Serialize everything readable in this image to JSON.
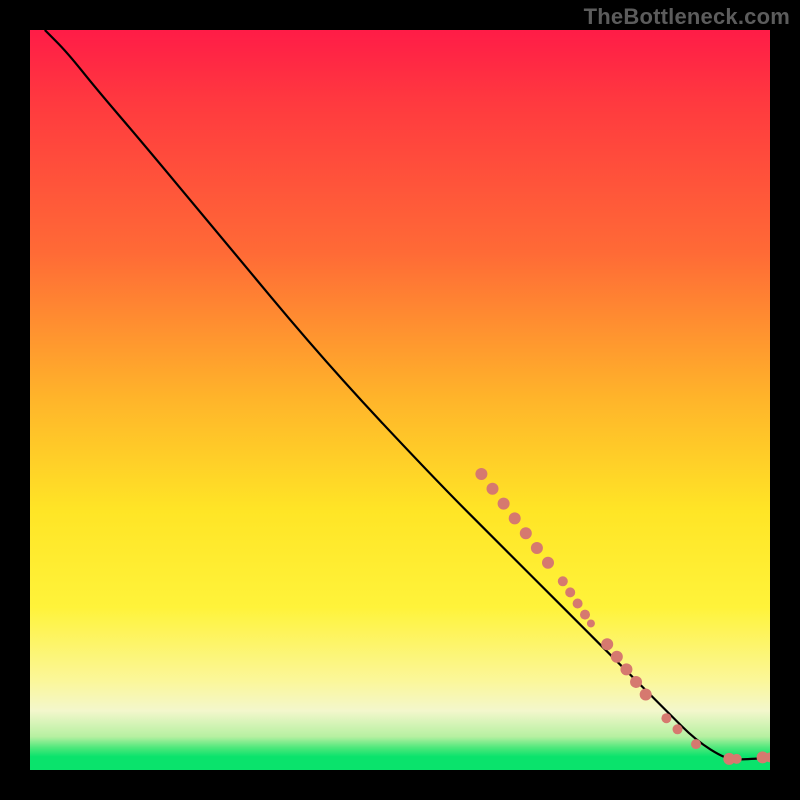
{
  "watermark": "TheBottleneck.com",
  "chart_data": {
    "type": "line",
    "title": "",
    "xlabel": "",
    "ylabel": "",
    "xlim": [
      0,
      100
    ],
    "ylim": [
      0,
      100
    ],
    "curve": [
      {
        "x": 2,
        "y": 100
      },
      {
        "x": 5,
        "y": 97
      },
      {
        "x": 9,
        "y": 92
      },
      {
        "x": 15,
        "y": 85
      },
      {
        "x": 25,
        "y": 73
      },
      {
        "x": 40,
        "y": 55
      },
      {
        "x": 55,
        "y": 39
      },
      {
        "x": 64,
        "y": 30
      },
      {
        "x": 72,
        "y": 22
      },
      {
        "x": 80,
        "y": 14
      },
      {
        "x": 86,
        "y": 8
      },
      {
        "x": 90,
        "y": 4
      },
      {
        "x": 94,
        "y": 1.5
      },
      {
        "x": 96,
        "y": 1.4
      },
      {
        "x": 99,
        "y": 1.6
      }
    ],
    "points_cluster_top": [
      {
        "x": 61,
        "y": 40,
        "r": 6
      },
      {
        "x": 62.5,
        "y": 38,
        "r": 6
      },
      {
        "x": 64,
        "y": 36,
        "r": 6
      },
      {
        "x": 65.5,
        "y": 34,
        "r": 6
      },
      {
        "x": 67,
        "y": 32,
        "r": 6
      },
      {
        "x": 68.5,
        "y": 30,
        "r": 6
      },
      {
        "x": 70,
        "y": 28,
        "r": 6
      }
    ],
    "points_cluster_mid": [
      {
        "x": 72,
        "y": 25.5,
        "r": 5
      },
      {
        "x": 73,
        "y": 24,
        "r": 5
      },
      {
        "x": 74,
        "y": 22.5,
        "r": 5
      },
      {
        "x": 75,
        "y": 21,
        "r": 5
      },
      {
        "x": 75.8,
        "y": 19.8,
        "r": 4
      }
    ],
    "points_cluster_low": [
      {
        "x": 78,
        "y": 17,
        "r": 6
      },
      {
        "x": 79.3,
        "y": 15.3,
        "r": 6
      },
      {
        "x": 80.6,
        "y": 13.6,
        "r": 6
      },
      {
        "x": 81.9,
        "y": 11.9,
        "r": 6
      },
      {
        "x": 83.2,
        "y": 10.2,
        "r": 6
      }
    ],
    "points_scatter": [
      {
        "x": 86,
        "y": 7,
        "r": 5
      },
      {
        "x": 87.5,
        "y": 5.5,
        "r": 5
      },
      {
        "x": 90,
        "y": 3.5,
        "r": 5
      },
      {
        "x": 94.5,
        "y": 1.5,
        "r": 6
      },
      {
        "x": 95.5,
        "y": 1.5,
        "r": 5
      },
      {
        "x": 99,
        "y": 1.7,
        "r": 6
      },
      {
        "x": 100,
        "y": 1.7,
        "r": 5
      }
    ]
  },
  "colors": {
    "point": "#d6796f",
    "curve": "#000000",
    "frame": "#000000",
    "watermark": "#5c5c5c"
  }
}
